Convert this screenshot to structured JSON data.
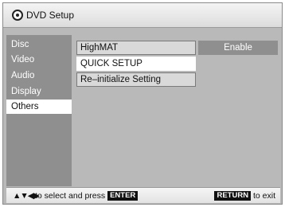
{
  "window": {
    "title": "DVD Setup"
  },
  "sidebar": {
    "items": [
      {
        "label": "Disc"
      },
      {
        "label": "Video"
      },
      {
        "label": "Audio"
      },
      {
        "label": "Display"
      },
      {
        "label": "Others"
      }
    ],
    "selected": "Others"
  },
  "content": {
    "items": [
      {
        "label": "HighMAT",
        "value": "Enable"
      },
      {
        "label": "QUICK SETUP"
      },
      {
        "label": "Re–initialize Setting"
      }
    ]
  },
  "footer": {
    "arrows": "▲▼◀▶",
    "text_left": "to select and press",
    "enter_key": "ENTER",
    "return_key": "RETURN",
    "text_right": "to exit"
  }
}
